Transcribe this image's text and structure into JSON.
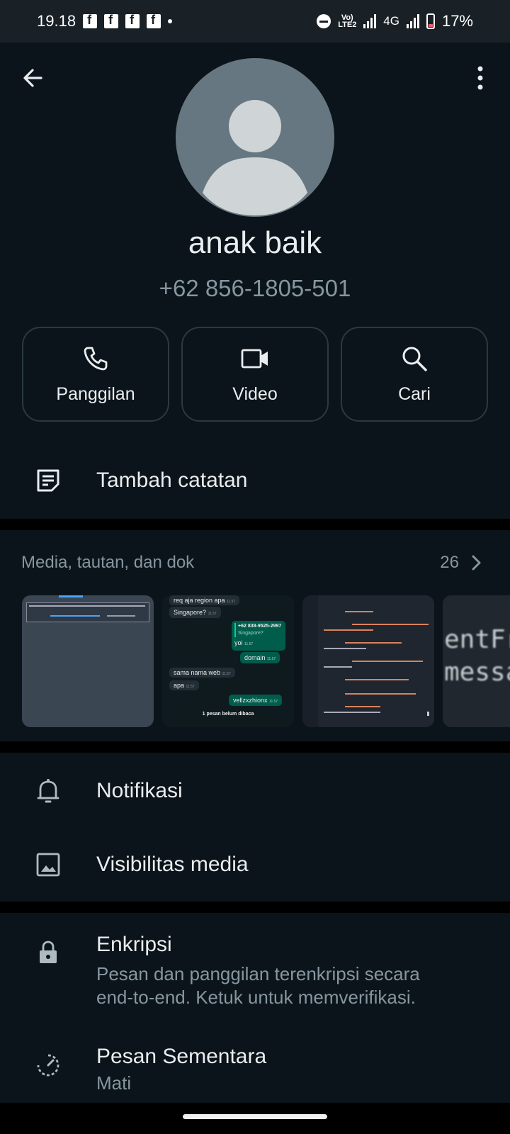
{
  "status_bar": {
    "time": "19.18",
    "network_label": "Vo) LTE2",
    "network_type": "4G",
    "battery": "17%"
  },
  "contact": {
    "name": "anak baik",
    "phone": "+62 856-1805-501"
  },
  "actions": [
    {
      "label": "Panggilan",
      "icon": "phone-icon"
    },
    {
      "label": "Video",
      "icon": "video-icon"
    },
    {
      "label": "Cari",
      "icon": "search-icon"
    }
  ],
  "note": {
    "label": "Tambah catatan"
  },
  "media": {
    "title": "Media, tautan, dan dok",
    "count": "26",
    "thumb2": {
      "msgs": [
        "req aja region apa",
        "Singapore?",
        "+62 838-9525-2997",
        "Singapore?",
        "yoi",
        "domain",
        "sama nama web",
        "apa",
        "vellzxzhionx",
        "1 pesan belum dibaca"
      ],
      "time": "11.57"
    },
    "thumb4_text": "entFr messa"
  },
  "settings": {
    "notifications": "Notifikasi",
    "media_visibility": "Visibilitas media",
    "encryption_title": "Enkripsi",
    "encryption_sub": "Pesan dan panggilan terenkripsi secara end-to-end. Ketuk untuk memverifikasi.",
    "disappearing_title": "Pesan Sementara",
    "disappearing_sub": "Mati"
  },
  "colors": {
    "background": "#0b141a",
    "card_border": "#2a3942",
    "secondary_text": "#8696a0",
    "avatar": "#667781"
  }
}
